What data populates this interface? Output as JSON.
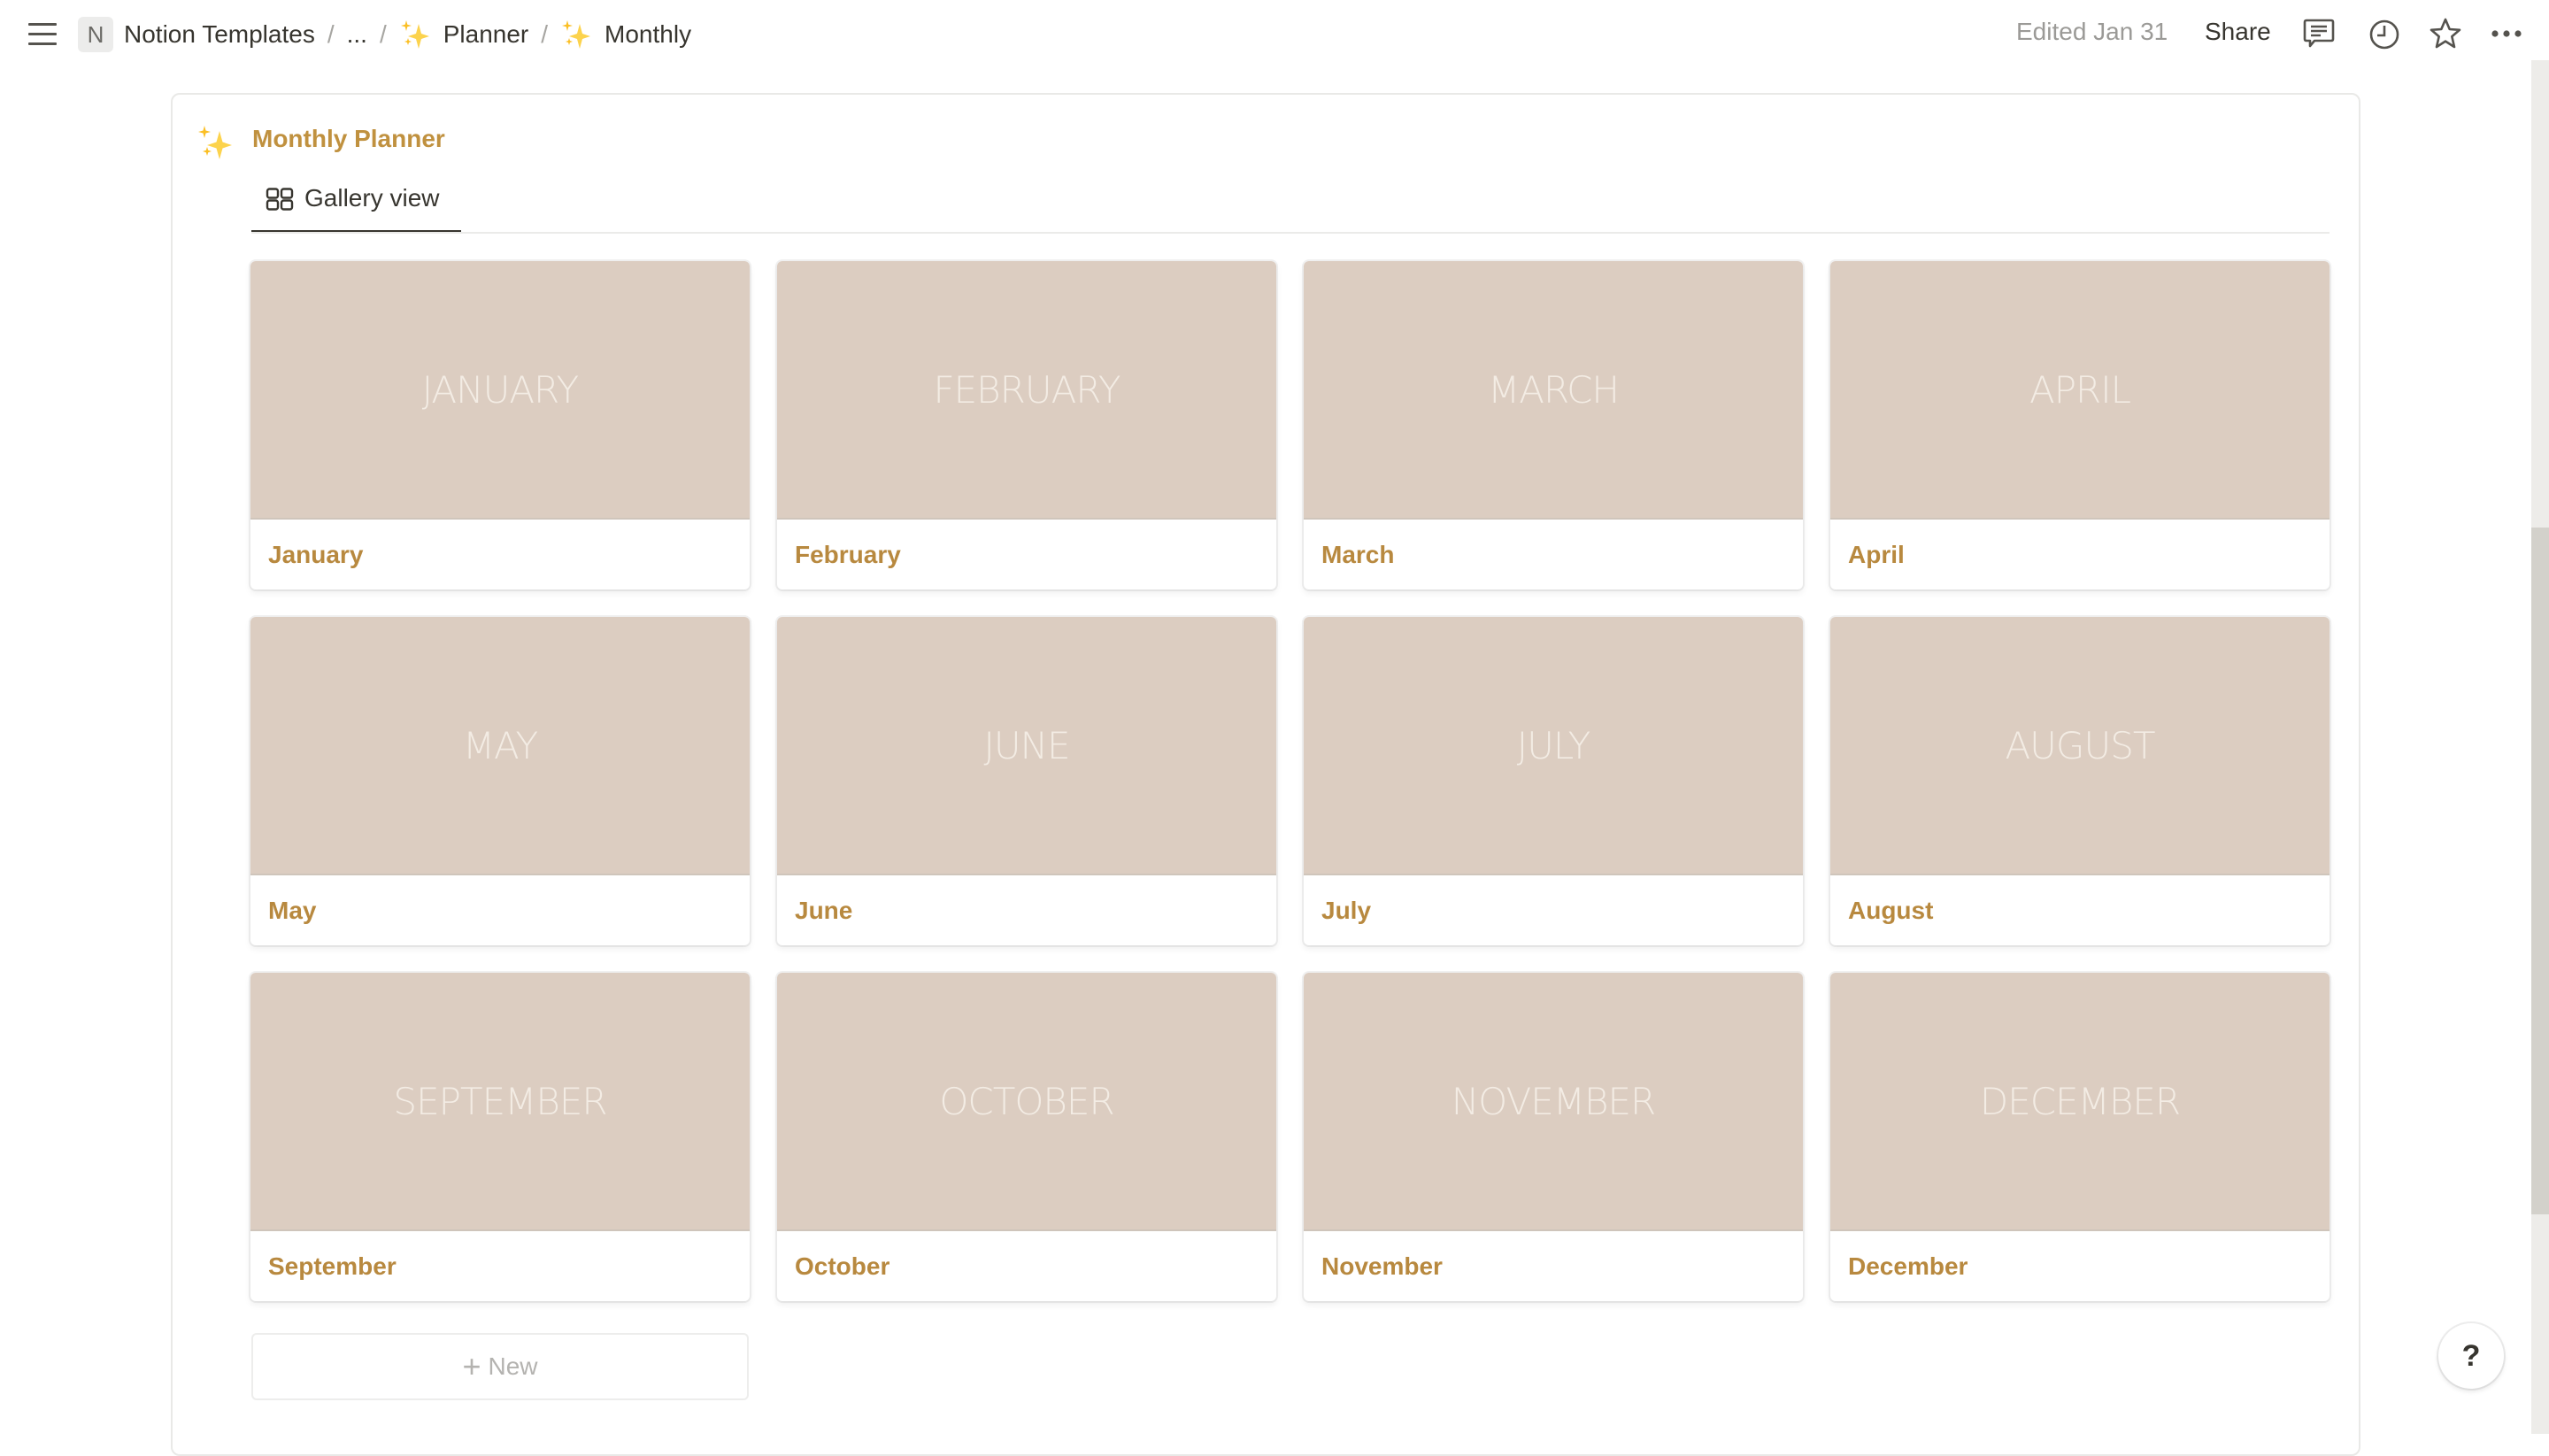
{
  "topbar": {
    "menu_icon": "hamburger-menu-icon",
    "workspace_badge": "N",
    "breadcrumbs": [
      {
        "label": "Notion Templates",
        "icon": null
      },
      {
        "label": "...",
        "icon": null
      },
      {
        "label": "Planner",
        "icon": "sparkles-icon"
      },
      {
        "label": "Monthly",
        "icon": "sparkles-icon"
      }
    ],
    "separator": "/",
    "edited": "Edited Jan 31",
    "share_label": "Share",
    "actions": [
      "comment-icon",
      "clock-history-icon",
      "star-icon",
      "more-dots-icon"
    ]
  },
  "database": {
    "icon": "sparkles-icon",
    "title": "Monthly Planner",
    "tabs": [
      {
        "label": "Gallery view",
        "icon": "gallery-grid-icon",
        "active": true
      }
    ],
    "cards": [
      {
        "cover_text": "JANUARY",
        "title": "January"
      },
      {
        "cover_text": "FEBRUARY",
        "title": "February"
      },
      {
        "cover_text": "MARCH",
        "title": "March"
      },
      {
        "cover_text": "APRIL",
        "title": "April"
      },
      {
        "cover_text": "MAY",
        "title": "May"
      },
      {
        "cover_text": "JUNE",
        "title": "June"
      },
      {
        "cover_text": "JULY",
        "title": "July"
      },
      {
        "cover_text": "AUGUST",
        "title": "August"
      },
      {
        "cover_text": "SEPTEMBER",
        "title": "September"
      },
      {
        "cover_text": "OCTOBER",
        "title": "October"
      },
      {
        "cover_text": "NOVEMBER",
        "title": "November"
      },
      {
        "cover_text": "DECEMBER",
        "title": "December"
      }
    ],
    "new_label": "New",
    "new_icon": "+"
  },
  "help": {
    "label": "?"
  },
  "scrollbar": {
    "position_fraction": 0.34,
    "visible_fraction": 0.5
  },
  "colors": {
    "accent_gold": "#c0913f",
    "card_title": "#b8893f",
    "cover_bg": "#dccdc1",
    "cover_text": "#f3ece4"
  }
}
